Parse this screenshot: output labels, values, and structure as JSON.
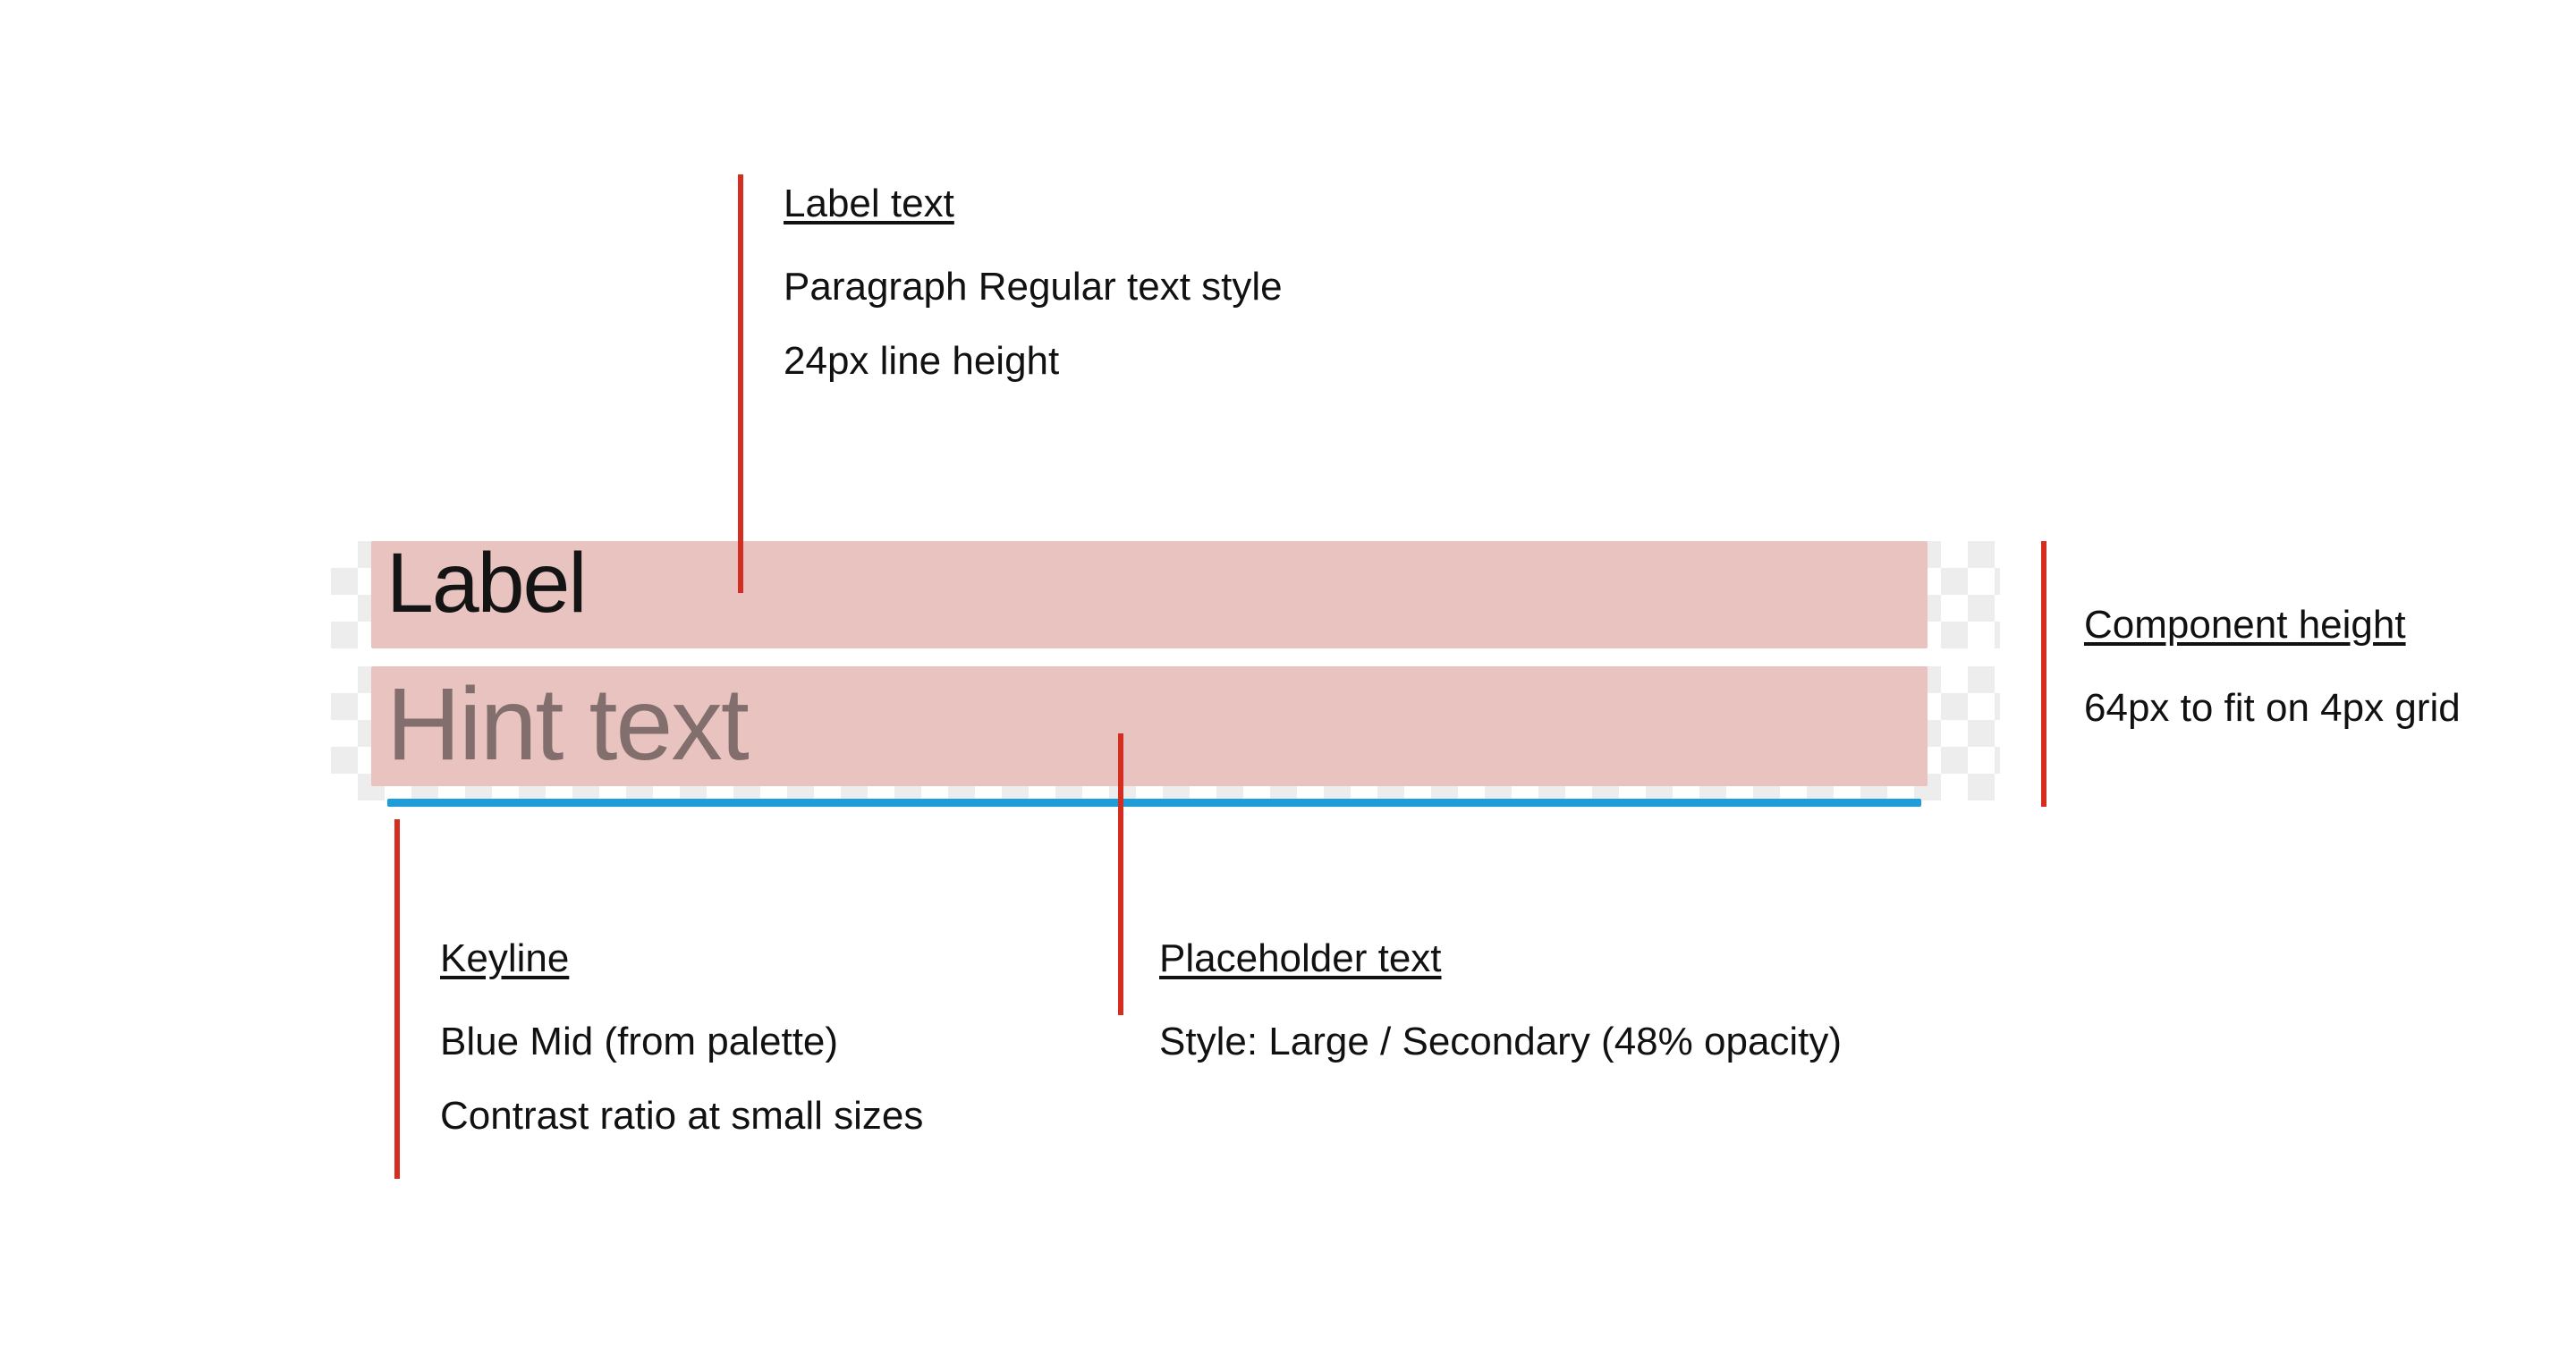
{
  "component": {
    "label_text": "Label",
    "hint_text": "Hint text"
  },
  "annotations": {
    "label": {
      "heading": "Label text",
      "line1": "Paragraph Regular text style",
      "line2": "24px line height"
    },
    "keyline": {
      "heading": "Keyline",
      "line1": "Blue Mid (from palette)",
      "line2": "Contrast ratio at small sizes"
    },
    "placeholder": {
      "heading": "Placeholder text",
      "line1": "Style: Large / Secondary (48% opacity)"
    },
    "height": {
      "heading": "Component height",
      "line1": "64px to fit on 4px grid"
    }
  }
}
